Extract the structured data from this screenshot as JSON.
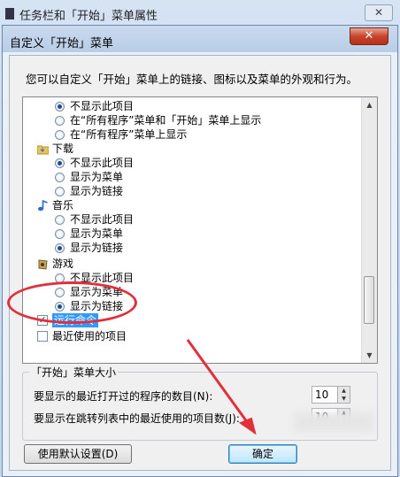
{
  "background_window": {
    "title": "任务栏和「开始」菜单属性",
    "close": "✕"
  },
  "dialog": {
    "title": "自定义「开始」菜单",
    "close": "✕"
  },
  "description": "您可以自定义「开始」菜单上的链接、图标以及菜单的外观和行为。",
  "list": {
    "top_options": [
      "不显示此项目",
      "在“所有程序”菜单和「开始」菜单上显示",
      "在“所有程序”菜单上显示"
    ],
    "categories": [
      {
        "label": "下载",
        "icon": "folder-download-icon",
        "options": [
          "不显示此项目",
          "显示为菜单",
          "显示为链接"
        ]
      },
      {
        "label": "音乐",
        "icon": "music-note-icon",
        "options": [
          "不显示此项目",
          "显示为菜单",
          "显示为链接"
        ]
      },
      {
        "label": "游戏",
        "icon": "games-icon",
        "options": [
          "不显示此项目",
          "显示为菜单",
          "显示为链接"
        ]
      }
    ],
    "check_run": "运行命令",
    "check_recent": "最近使用的项目"
  },
  "menu_size": {
    "legend": "「开始」菜单大小",
    "recent_programs_label": "要显示的最近打开过的程序的数目(N):",
    "recent_programs_value": "10",
    "jump_list_label": "要显示在跳转列表中的最近使用的项目数(J):",
    "jump_list_value": "10"
  },
  "buttons": {
    "defaults": "使用默认设置(D)",
    "ok": "确定"
  },
  "colors": {
    "annotation": "#e0303b",
    "selection": "#3399ff"
  }
}
